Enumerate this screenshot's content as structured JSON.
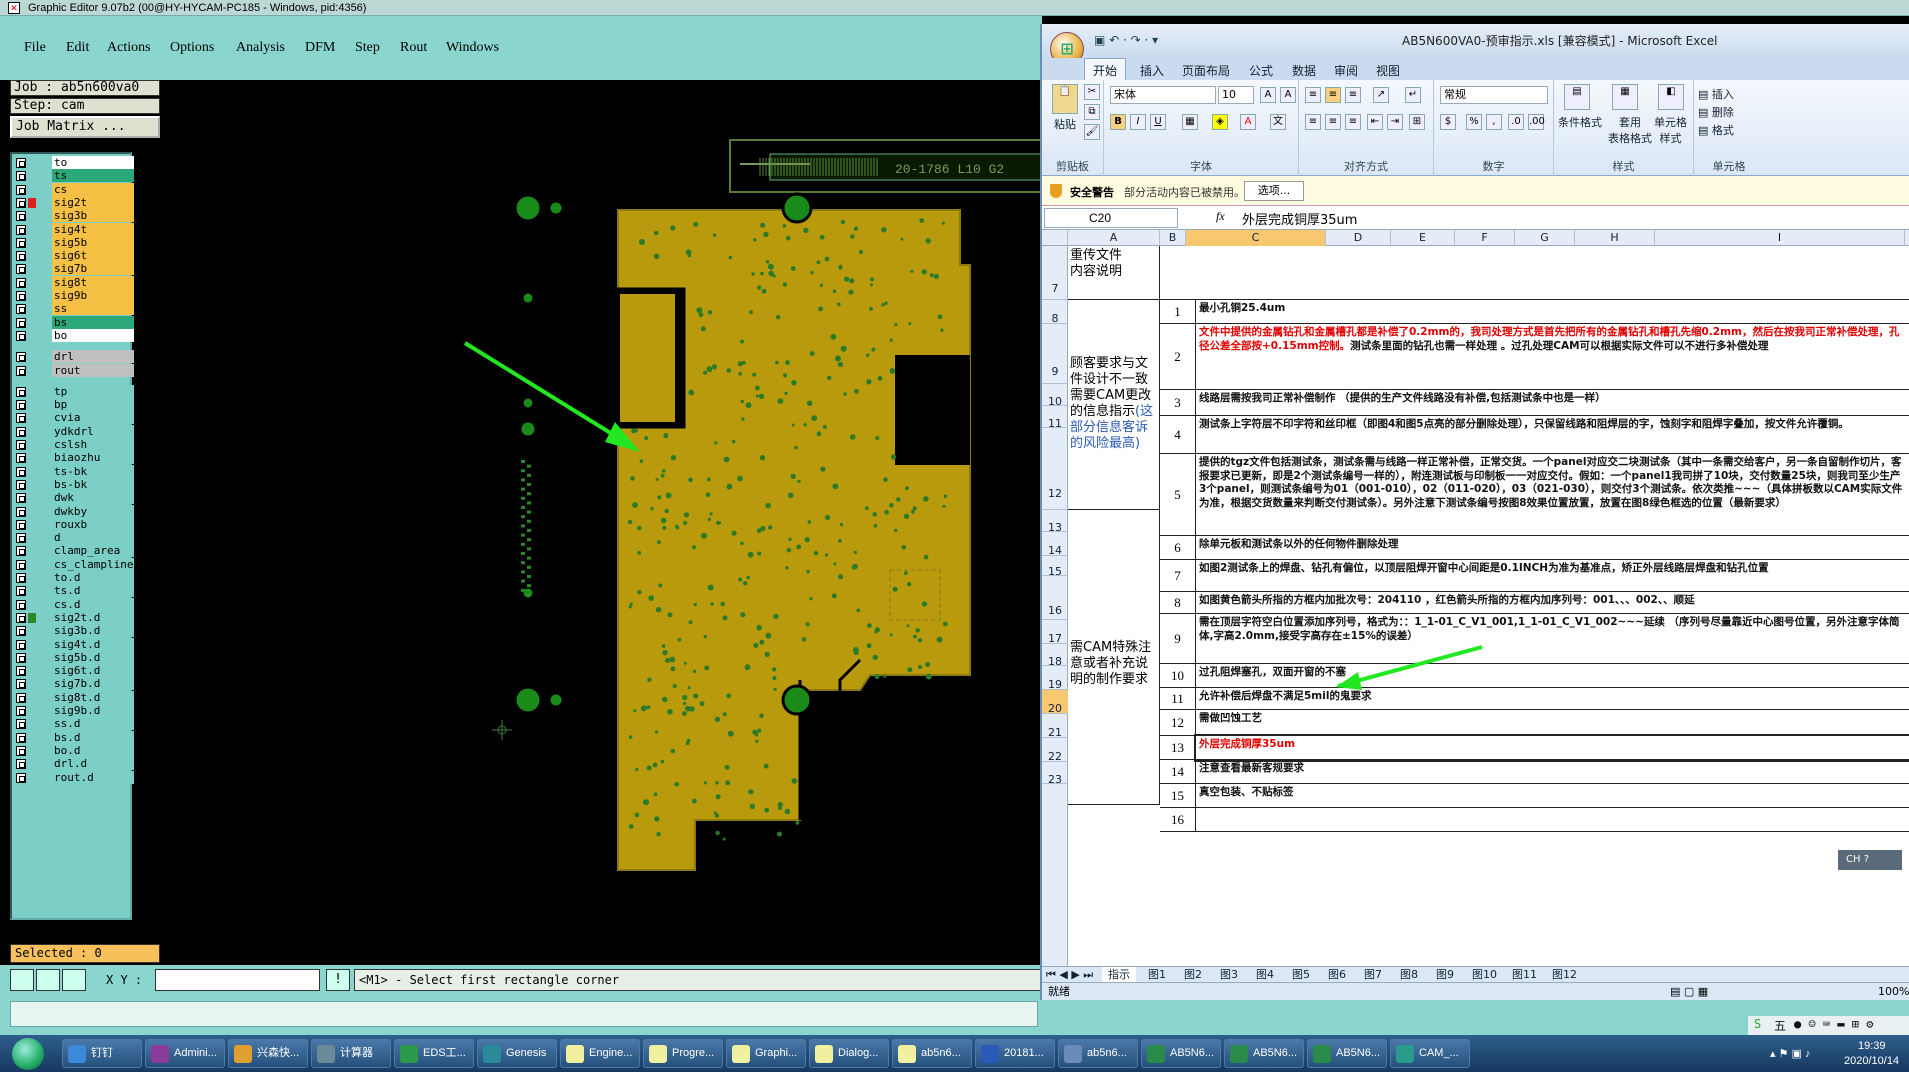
{
  "ge": {
    "title": "Graphic Editor 9.07b2 (00@HY-HYCAM-PC185 - Windows, pid:4356)",
    "menu": [
      "File",
      "Edit",
      "Actions",
      "Options",
      "Analysis",
      "DFM",
      "Step",
      "Rout",
      "Windows"
    ],
    "job": "Job : ab5n600va0",
    "step": "Step: cam",
    "job_matrix": "Job Matrix ...",
    "layers": [
      {
        "n": "to",
        "c": "#ffffff"
      },
      {
        "n": "ts",
        "c": "#2aa87a"
      },
      {
        "n": "cs",
        "c": "#f5c044"
      },
      {
        "n": "sig2t",
        "c": "#f5c044",
        "act": true
      },
      {
        "n": "sig3b",
        "c": "#f5c044"
      },
      {
        "n": "sig4t",
        "c": "#f5c044"
      },
      {
        "n": "sig5b",
        "c": "#f5c044"
      },
      {
        "n": "sig6t",
        "c": "#f5c044"
      },
      {
        "n": "sig7b",
        "c": "#f5c044"
      },
      {
        "n": "sig8t",
        "c": "#f5c044"
      },
      {
        "n": "sig9b",
        "c": "#f5c044"
      },
      {
        "n": "ss",
        "c": "#f5c044"
      },
      {
        "n": "bs",
        "c": "#2aa87a"
      },
      {
        "n": "bo",
        "c": "#ffffff"
      },
      {
        "n": "drl",
        "c": "#c0c0c0"
      },
      {
        "n": "rout",
        "c": "#c0c0c0"
      },
      {
        "n": "tp",
        "c": "#7ccfc6"
      },
      {
        "n": "bp",
        "c": "#7ccfc6"
      },
      {
        "n": "cvia",
        "c": "#7ccfc6"
      },
      {
        "n": "ydkdrl",
        "c": "#7ccfc6"
      },
      {
        "n": "cslsh",
        "c": "#7ccfc6"
      },
      {
        "n": "biaozhu",
        "c": "#7ccfc6"
      },
      {
        "n": "ts-bk",
        "c": "#7ccfc6"
      },
      {
        "n": "bs-bk",
        "c": "#7ccfc6"
      },
      {
        "n": "dwk",
        "c": "#7ccfc6"
      },
      {
        "n": "dwkby",
        "c": "#7ccfc6"
      },
      {
        "n": "rouxb",
        "c": "#7ccfc6"
      },
      {
        "n": "d",
        "c": "#7ccfc6"
      },
      {
        "n": "clamp_area",
        "c": "#7ccfc6"
      },
      {
        "n": "cs_clampline",
        "c": "#7ccfc6"
      },
      {
        "n": "to.d",
        "c": "#7ccfc6"
      },
      {
        "n": "ts.d",
        "c": "#7ccfc6"
      },
      {
        "n": "cs.d",
        "c": "#7ccfc6"
      },
      {
        "n": "sig2t.d",
        "c": "#7ccfc6",
        "act2": true
      },
      {
        "n": "sig3b.d",
        "c": "#7ccfc6"
      },
      {
        "n": "sig4t.d",
        "c": "#7ccfc6"
      },
      {
        "n": "sig5b.d",
        "c": "#7ccfc6"
      },
      {
        "n": "sig6t.d",
        "c": "#7ccfc6"
      },
      {
        "n": "sig7b.d",
        "c": "#7ccfc6"
      },
      {
        "n": "sig8t.d",
        "c": "#7ccfc6"
      },
      {
        "n": "sig9b.d",
        "c": "#7ccfc6"
      },
      {
        "n": "ss.d",
        "c": "#7ccfc6"
      },
      {
        "n": "bs.d",
        "c": "#7ccfc6"
      },
      {
        "n": "bo.d",
        "c": "#7ccfc6"
      },
      {
        "n": "drl.d",
        "c": "#7ccfc6"
      },
      {
        "n": "rout.d",
        "c": "#7ccfc6"
      }
    ],
    "selected": "Selected : 0",
    "xy_label": "X Y :",
    "hint_button": "!",
    "hint": "<M1> - Select first rectangle corner",
    "board_text": "20-1786 L10 G2"
  },
  "excel": {
    "title": "AB5N600VA0-预审指示.xls [兼容模式] - Microsoft Excel",
    "tabs": [
      "开始",
      "插入",
      "页面布局",
      "公式",
      "数据",
      "审阅",
      "视图"
    ],
    "ribbon": {
      "paste": "粘贴",
      "clipboard": "剪贴板",
      "font_name": "宋体",
      "font_size": "10",
      "font": "字体",
      "align": "对齐方式",
      "num_format": "常规",
      "number": "数字",
      "cond_fmt": "条件格式",
      "table_fmt": "套用\n表格格式",
      "cell_style": "单元格\n样式",
      "styles": "样式",
      "insert": "插入",
      "delete": "删除",
      "format": "格式",
      "cells": "单元格"
    },
    "security": {
      "title": "安全警告",
      "message": "部分活动内容已被禁用。",
      "button": "选项..."
    },
    "name_box": "C20",
    "fx": "fx",
    "formula": "外层完成铜厚35um",
    "cols": [
      "A",
      "B",
      "C",
      "D",
      "E",
      "F",
      "G",
      "H",
      "I"
    ],
    "rows": [
      "7",
      "8",
      "9",
      "10",
      "11",
      "12",
      "13",
      "14",
      "15",
      "16",
      "17",
      "18",
      "19",
      "20",
      "21",
      "22",
      "23"
    ],
    "cat1": "重传文件\n内容说明",
    "cat2a": "顾客要求与文件设计不一致需要CAM更改的信息指示",
    "cat2b": "(这部分信息客诉的风险最高)",
    "cat3": "需CAM特殊注意或者补充说明的制作要求",
    "items": [
      {
        "n": "1",
        "t": "最小孔铜25.4um"
      },
      {
        "n": "2",
        "t": "文件中提供的金属钻孔和金属槽孔都是补偿了0.2mm的，我司处理方式是首先把所有的金属钻孔和槽孔先缩0.2mm，然后在按我司正常补偿处理，孔径公差全部按+0.15mm控制。",
        "t2": "测试条里面的钻孔也需一样处理 。过孔处理CAM可以根据实际文件可以不进行多补偿处理"
      },
      {
        "n": "3",
        "t": "线路层需按我司正常补偿制作 （提供的生产文件线路没有补偿,包括测试条中也是一样）"
      },
      {
        "n": "4",
        "t": "测试条上字符层不印字符和丝印框（即图4和图5点亮的部分删除处理），只保留线路和阻焊层的字，蚀刻字和阻焊字叠加，按文件允许覆铜。"
      },
      {
        "n": "5",
        "t": "提供的tgz文件包括测试条，测试条需与线路一样正常补偿，正常交货。一个panel对应交二块测试条（其中一条需交给客户，另一条自留制作切片，客报要求已更新，即是2个测试条编号一样的），附连测试板与印制板一一对应交付。假如：一个panel1我司拼了10块，交付数量25块，则我司至少生产3个panel，则测试条编号为01（001-010），02（011-020），03（021-030），则交付3个测试条。依次类推~~~（具体拼板数以CAM实际文件为准，根据交货数量来判断交付测试条）。另外注意下测试条编号按图8效果位置放置，放置在图8绿色框选的位置（最新要求）"
      },
      {
        "n": "6",
        "t": "除单元板和测试条以外的任何物件删除处理"
      },
      {
        "n": "7",
        "t": "如图2测试条上的焊盘、钻孔有偏位，以顶层阻焊开窗中心间距是0.1INCH为准为基准点，矫正外层线路层焊盘和钻孔位置"
      },
      {
        "n": "8",
        "t": "如图黄色箭头所指的方框内加批次号：204110 ，红色箭头所指的方框内加序列号：001、、、002、、顺延"
      },
      {
        "n": "9",
        "t": "需在顶层字符空白位置添加序列号，格式为：：1_1-01_C_V1_001,1_1-01_C_V1_002~~~延续 （序列号尽量靠近中心图号位置，另外注意字体简体,字高2.0mm,接受字高存在±15%的误差）"
      },
      {
        "n": "10",
        "t": "过孔阻焊塞孔，双面开窗的不塞"
      },
      {
        "n": "11",
        "t": "允许补偿后焊盘不满足5mil的鬼要求"
      },
      {
        "n": "12",
        "t": "需做凹蚀工艺"
      },
      {
        "n": "13",
        "t": "外层完成铜厚35um"
      },
      {
        "n": "14",
        "t": "注意查看最新客规要求"
      },
      {
        "n": "15",
        "t": "真空包装、不贴标签"
      },
      {
        "n": "16",
        "t": ""
      }
    ],
    "sheets": [
      "指示",
      "图1",
      "图2",
      "图3",
      "图4",
      "图5",
      "图6",
      "图7",
      "图8",
      "图9",
      "图10",
      "图11",
      "图12"
    ],
    "status": "就绪",
    "zoom": "100%",
    "ch_badge": "CH"
  },
  "taskbar": {
    "items": [
      "钉钉",
      "Admini...",
      "兴森快...",
      "计算器",
      "EDS工...",
      "Genesis",
      "Engine...",
      "Progre...",
      "Graphi...",
      "Dialog...",
      "ab5n6...",
      "20181...",
      "ab5n6...",
      "AB5N6...",
      "AB5N6...",
      "AB5N6...",
      "CAM_..."
    ],
    "time": "19:39",
    "date": "2020/10/14",
    "ime": "五"
  }
}
